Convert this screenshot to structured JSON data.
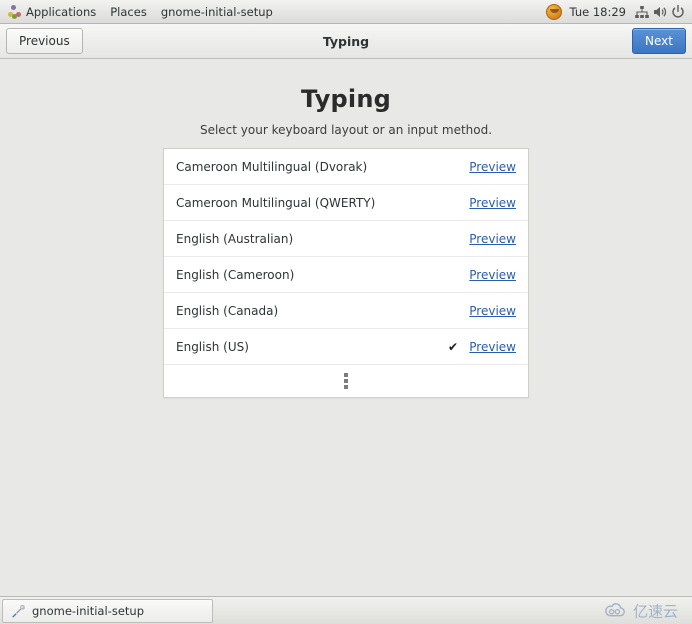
{
  "top_panel": {
    "applications_label": "Applications",
    "places_label": "Places",
    "window_label": "gnome-initial-setup",
    "clock": "Tue 18:29",
    "icons": {
      "menu": "gnome-foot-icon",
      "avatar": "user-avatar-icon",
      "network": "network-icon",
      "volume": "volume-icon",
      "power": "power-icon"
    }
  },
  "headerbar": {
    "previous_label": "Previous",
    "title": "Typing",
    "next_label": "Next",
    "next_color": "#3c76c4"
  },
  "page": {
    "title": "Typing",
    "subtitle": "Select your keyboard layout or an input method."
  },
  "layout_list": {
    "preview_label": "Preview",
    "check_glyph": "✔",
    "rows": [
      {
        "label": "Cameroon Multilingual (Dvorak)",
        "selected": false
      },
      {
        "label": "Cameroon Multilingual (QWERTY)",
        "selected": false
      },
      {
        "label": "English (Australian)",
        "selected": false
      },
      {
        "label": "English (Cameroon)",
        "selected": false
      },
      {
        "label": "English (Canada)",
        "selected": false
      },
      {
        "label": "English (US)",
        "selected": true
      }
    ],
    "more_row": {
      "icon": "more-vertical-icon"
    }
  },
  "taskbar": {
    "window_button_label": "gnome-initial-setup",
    "window_button_icon": "gnome-initial-setup-icon"
  },
  "watermark": {
    "text": "亿速云",
    "icon": "cloud-icon",
    "color": "#9fb4c8"
  }
}
